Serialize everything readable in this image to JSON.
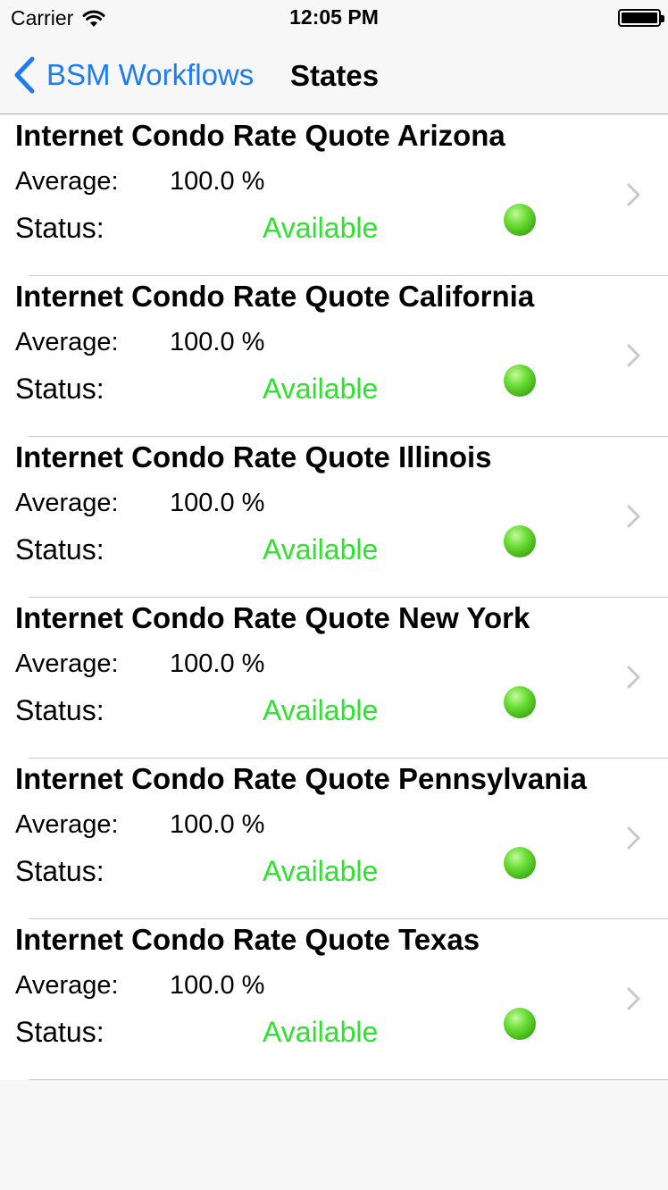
{
  "status_bar": {
    "carrier": "Carrier",
    "time": "12:05 PM"
  },
  "nav": {
    "back_label": "BSM Workflows",
    "title": "States"
  },
  "colors": {
    "accent": "#1e7cf2",
    "available": "#2ee32e",
    "indicator": "#4fc21f"
  },
  "rows": [
    {
      "title": "Internet Condo Rate Quote Arizona",
      "average_label": "Average:",
      "average_value": "100.0 %",
      "status_label": "Status:",
      "status_value": "Available"
    },
    {
      "title": "Internet Condo Rate Quote California",
      "average_label": "Average:",
      "average_value": "100.0 %",
      "status_label": "Status:",
      "status_value": "Available"
    },
    {
      "title": "Internet Condo Rate Quote Illinois",
      "average_label": "Average:",
      "average_value": "100.0 %",
      "status_label": "Status:",
      "status_value": "Available"
    },
    {
      "title": "Internet Condo Rate Quote New York",
      "average_label": "Average:",
      "average_value": "100.0 %",
      "status_label": "Status:",
      "status_value": "Available"
    },
    {
      "title": "Internet Condo Rate Quote Pennsylvania",
      "average_label": "Average:",
      "average_value": "100.0 %",
      "status_label": "Status:",
      "status_value": "Available"
    },
    {
      "title": "Internet Condo Rate Quote Texas",
      "average_label": "Average:",
      "average_value": "100.0 %",
      "status_label": "Status:",
      "status_value": "Available"
    }
  ]
}
